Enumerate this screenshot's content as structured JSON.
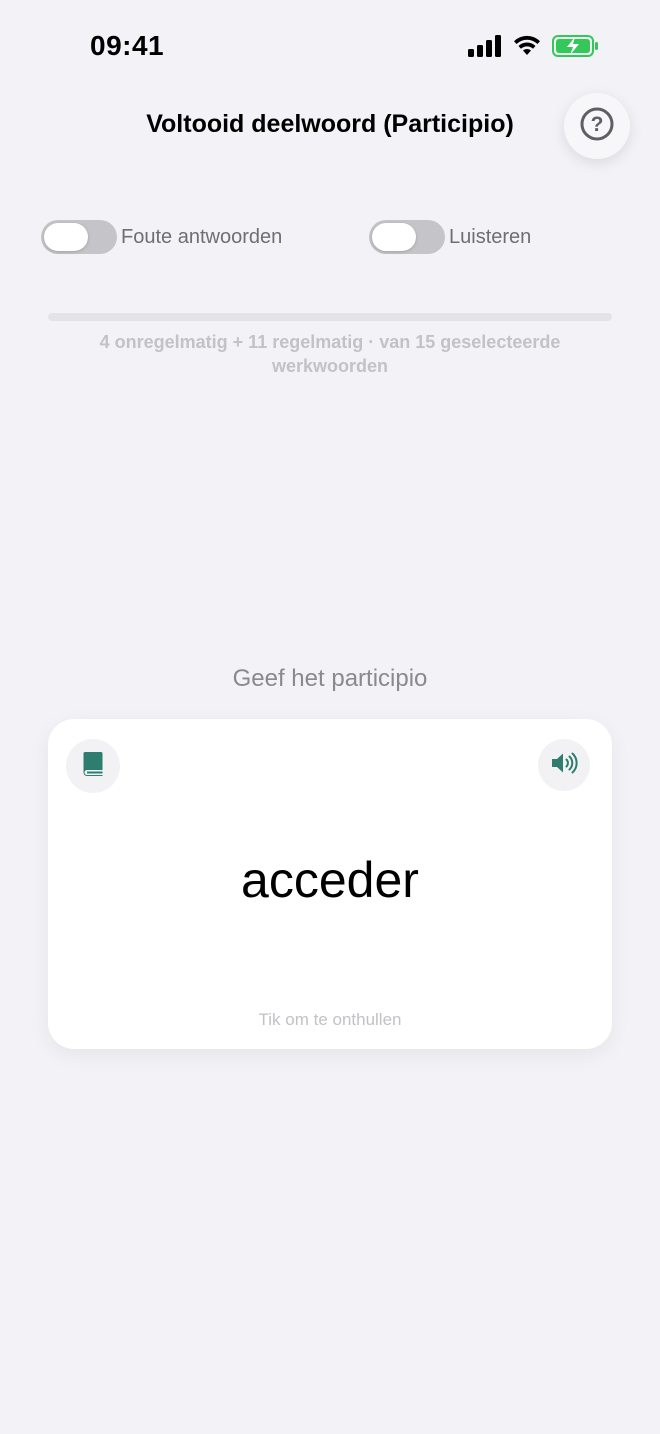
{
  "status_bar": {
    "time": "09:41",
    "icons": [
      "cellular-signal-icon",
      "wifi-icon",
      "battery-charging-icon"
    ]
  },
  "header": {
    "title": "Voltooid deelwoord (Participio)",
    "help_icon": "question-circle-icon",
    "help_glyph": "?"
  },
  "toggles": [
    {
      "label": "Foute antwoorden",
      "on": false
    },
    {
      "label": "Luisteren",
      "on": false
    }
  ],
  "progress": {
    "fraction": 0,
    "caption": "4 onregelmatig + 11 regelmatig · van 15 geselecteerde werkwoorden"
  },
  "prompt": "Geef het participio",
  "card": {
    "word": "acceder",
    "hint": "Tik om te onthullen",
    "book_icon": "book-icon",
    "speaker_icon": "speaker-icon"
  },
  "colors": {
    "accent": "#2e7d6f",
    "background": "#f2f2f7",
    "battery": "#34c759"
  }
}
